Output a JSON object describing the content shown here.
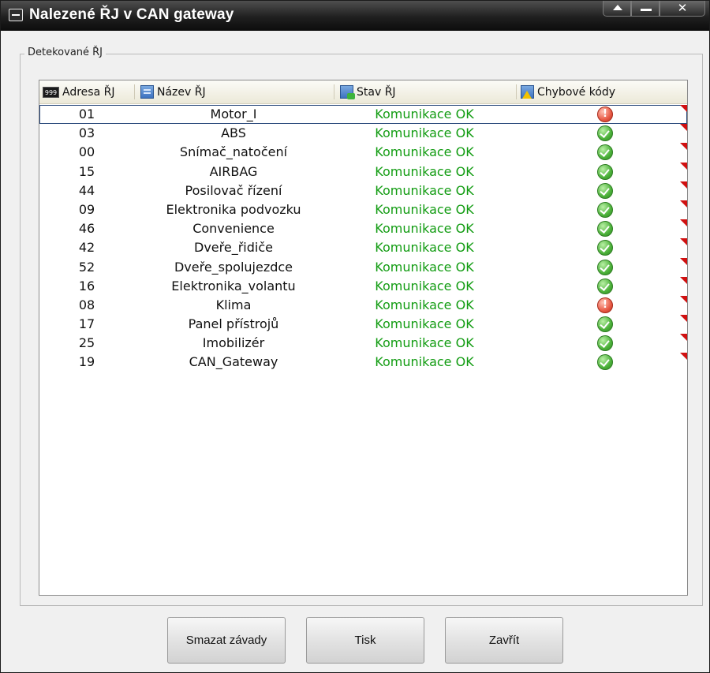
{
  "window": {
    "title": "Nalezené ŘJ v CAN gateway"
  },
  "titlebar_buttons": {
    "close": "✕"
  },
  "group": {
    "label": "Detekované ŘJ"
  },
  "columns": {
    "address": "Adresa ŘJ",
    "name": "Název ŘJ",
    "status": "Stav ŘJ",
    "errors": "Chybové kódy"
  },
  "column_icons": {
    "address": "999",
    "address_icon": "numeric-icon",
    "name_icon": "document-icon",
    "status_icon": "document-status-icon",
    "errors_icon": "document-warning-icon"
  },
  "rows": [
    {
      "address": "01",
      "name": "Motor_I",
      "status": "Komunikace OK",
      "error_state": "error"
    },
    {
      "address": "03",
      "name": "ABS",
      "status": "Komunikace OK",
      "error_state": "ok"
    },
    {
      "address": "00",
      "name": "Snímač_natočení",
      "status": "Komunikace OK",
      "error_state": "ok"
    },
    {
      "address": "15",
      "name": "AIRBAG",
      "status": "Komunikace OK",
      "error_state": "ok"
    },
    {
      "address": "44",
      "name": "Posilovač řízení",
      "status": "Komunikace OK",
      "error_state": "ok"
    },
    {
      "address": "09",
      "name": "Elektronika podvozku",
      "status": "Komunikace OK",
      "error_state": "ok"
    },
    {
      "address": "46",
      "name": "Convenience",
      "status": "Komunikace OK",
      "error_state": "ok"
    },
    {
      "address": "42",
      "name": "Dveře_řidiče",
      "status": "Komunikace OK",
      "error_state": "ok"
    },
    {
      "address": "52",
      "name": "Dveře_spolujezdce",
      "status": "Komunikace OK",
      "error_state": "ok"
    },
    {
      "address": "16",
      "name": "Elektronika_volantu",
      "status": "Komunikace OK",
      "error_state": "ok"
    },
    {
      "address": "08",
      "name": "Klima",
      "status": "Komunikace OK",
      "error_state": "error"
    },
    {
      "address": "17",
      "name": "Panel přístrojů",
      "status": "Komunikace OK",
      "error_state": "ok"
    },
    {
      "address": "25",
      "name": "Imobilizér",
      "status": "Komunikace OK",
      "error_state": "ok"
    },
    {
      "address": "19",
      "name": "CAN_Gateway",
      "status": "Komunikace OK",
      "error_state": "ok"
    }
  ],
  "selected_row": 0,
  "buttons": {
    "clear": "Smazat závady",
    "print": "Tisk",
    "close": "Zavřít"
  },
  "colors": {
    "status_ok_text": "#129c12",
    "error_flag": "#d01010",
    "titlebar": "#1f1f1f"
  }
}
